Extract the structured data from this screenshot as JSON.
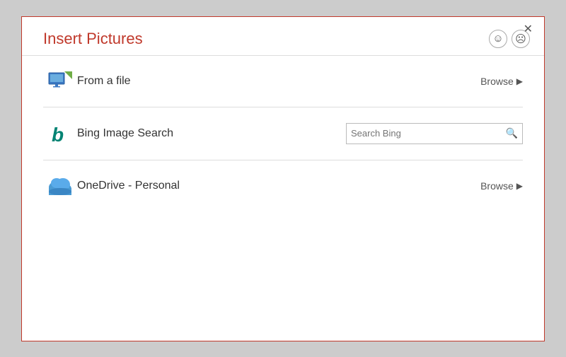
{
  "dialog": {
    "title": "Insert Pictures",
    "close_label": "✕"
  },
  "feedback": {
    "happy_icon": "☺",
    "sad_icon": "☹"
  },
  "rows": [
    {
      "id": "from-file",
      "label": "From a file",
      "action_type": "browse",
      "action_label": "Browse",
      "arrow": "▶"
    },
    {
      "id": "bing-image-search",
      "label": "Bing Image Search",
      "action_type": "search",
      "search_placeholder": "Search Bing"
    },
    {
      "id": "onedrive-personal",
      "label": "OneDrive - Personal",
      "action_type": "browse",
      "action_label": "Browse",
      "arrow": "▶"
    }
  ]
}
